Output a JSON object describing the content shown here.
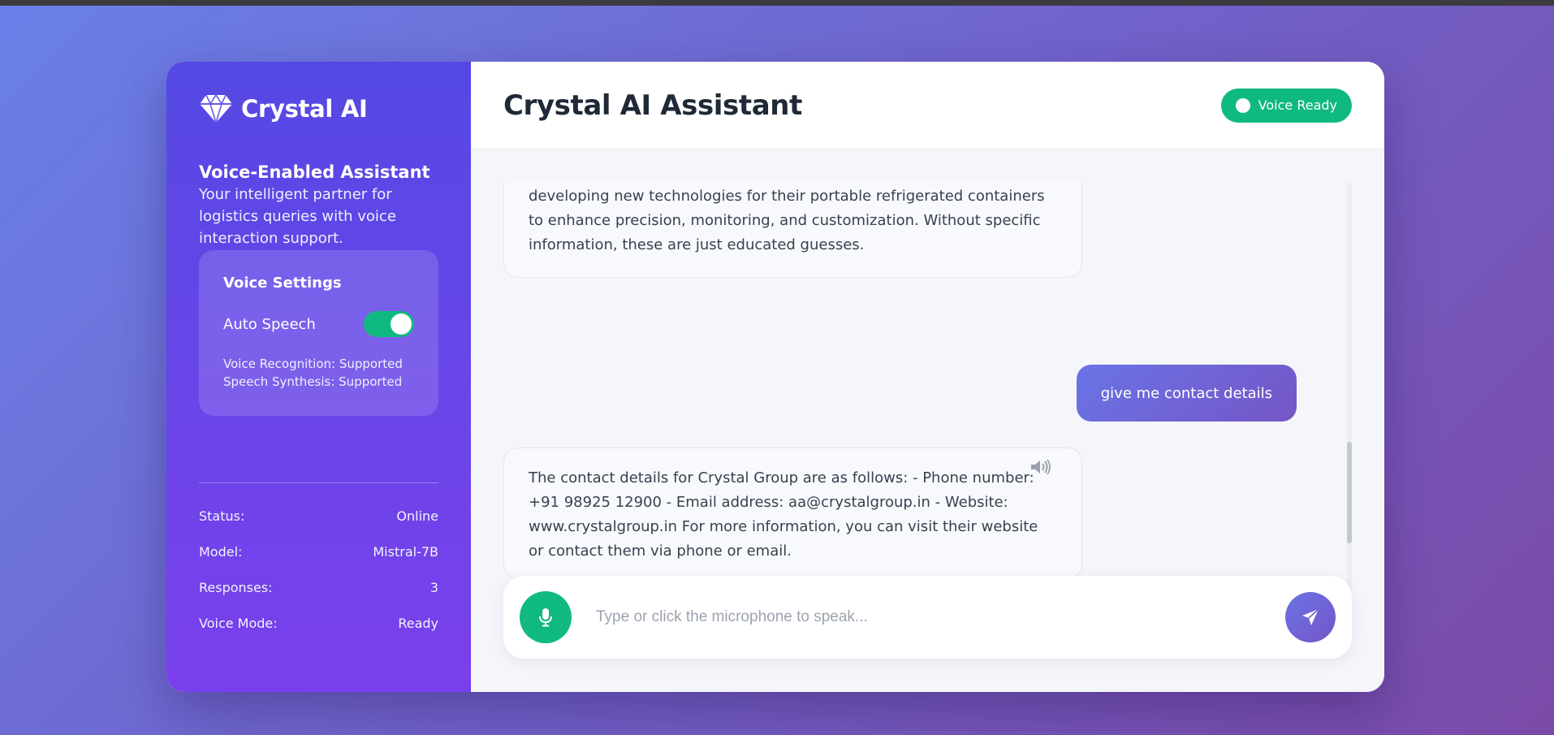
{
  "sidebar": {
    "brand": {
      "icon": "diamond-icon",
      "name": "Crystal AI"
    },
    "intro": {
      "title": "Voice-Enabled Assistant",
      "text": "Your intelligent partner for logistics queries with voice interaction support."
    },
    "voice_settings": {
      "title": "Voice Settings",
      "auto_speech_label": "Auto Speech",
      "auto_speech_on": true,
      "voice_recognition": "Voice Recognition: Supported",
      "speech_synthesis": "Speech Synthesis: Supported"
    },
    "stats": [
      {
        "label": "Status:",
        "value": "Online"
      },
      {
        "label": "Model:",
        "value": "Mistral-7B"
      },
      {
        "label": "Responses:",
        "value": "3"
      },
      {
        "label": "Voice Mode:",
        "value": "Ready"
      }
    ]
  },
  "header": {
    "title": "Crystal AI Assistant",
    "badge": "Voice Ready"
  },
  "messages": [
    {
      "role": "assistant",
      "text": "storage solutions, improving their refrigerated vehicles, and potentially developing new technologies for their portable refrigerated containers to enhance precision, monitoring, and customization. Without specific information, these are just educated guesses."
    },
    {
      "role": "user",
      "text": "give me contact details"
    },
    {
      "role": "assistant",
      "text": "The contact details for Crystal Group are as follows: - Phone number: +91 98925 12900 - Email address: aa@crystalgroup.in - Website: www.crystalgroup.in For more information, you can visit their website or contact them via phone or email.",
      "icon": "speaker-icon"
    }
  ],
  "input": {
    "value": "",
    "placeholder": "Type or click the microphone to speak...",
    "mic_icon": "microphone-icon",
    "send_icon": "send-icon"
  },
  "colors": {
    "accent": "#5548e4",
    "success": "#10b981",
    "user_bubble": "#6a74e6"
  }
}
